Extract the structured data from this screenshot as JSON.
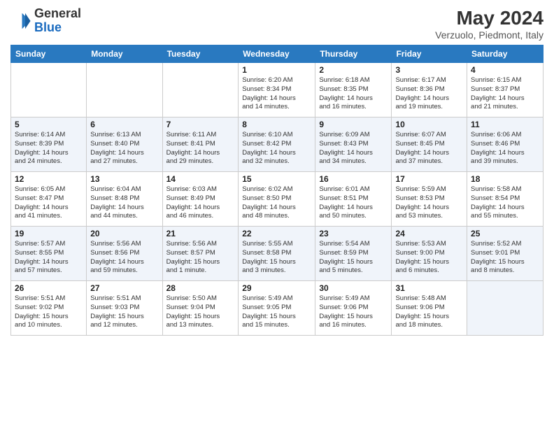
{
  "header": {
    "logo": {
      "line1": "General",
      "line2": "Blue"
    },
    "title": "May 2024",
    "location": "Verzuolo, Piedmont, Italy"
  },
  "weekdays": [
    "Sunday",
    "Monday",
    "Tuesday",
    "Wednesday",
    "Thursday",
    "Friday",
    "Saturday"
  ],
  "weeks": [
    [
      {
        "day": "",
        "info": ""
      },
      {
        "day": "",
        "info": ""
      },
      {
        "day": "",
        "info": ""
      },
      {
        "day": "1",
        "info": "Sunrise: 6:20 AM\nSunset: 8:34 PM\nDaylight: 14 hours\nand 14 minutes."
      },
      {
        "day": "2",
        "info": "Sunrise: 6:18 AM\nSunset: 8:35 PM\nDaylight: 14 hours\nand 16 minutes."
      },
      {
        "day": "3",
        "info": "Sunrise: 6:17 AM\nSunset: 8:36 PM\nDaylight: 14 hours\nand 19 minutes."
      },
      {
        "day": "4",
        "info": "Sunrise: 6:15 AM\nSunset: 8:37 PM\nDaylight: 14 hours\nand 21 minutes."
      }
    ],
    [
      {
        "day": "5",
        "info": "Sunrise: 6:14 AM\nSunset: 8:39 PM\nDaylight: 14 hours\nand 24 minutes."
      },
      {
        "day": "6",
        "info": "Sunrise: 6:13 AM\nSunset: 8:40 PM\nDaylight: 14 hours\nand 27 minutes."
      },
      {
        "day": "7",
        "info": "Sunrise: 6:11 AM\nSunset: 8:41 PM\nDaylight: 14 hours\nand 29 minutes."
      },
      {
        "day": "8",
        "info": "Sunrise: 6:10 AM\nSunset: 8:42 PM\nDaylight: 14 hours\nand 32 minutes."
      },
      {
        "day": "9",
        "info": "Sunrise: 6:09 AM\nSunset: 8:43 PM\nDaylight: 14 hours\nand 34 minutes."
      },
      {
        "day": "10",
        "info": "Sunrise: 6:07 AM\nSunset: 8:45 PM\nDaylight: 14 hours\nand 37 minutes."
      },
      {
        "day": "11",
        "info": "Sunrise: 6:06 AM\nSunset: 8:46 PM\nDaylight: 14 hours\nand 39 minutes."
      }
    ],
    [
      {
        "day": "12",
        "info": "Sunrise: 6:05 AM\nSunset: 8:47 PM\nDaylight: 14 hours\nand 41 minutes."
      },
      {
        "day": "13",
        "info": "Sunrise: 6:04 AM\nSunset: 8:48 PM\nDaylight: 14 hours\nand 44 minutes."
      },
      {
        "day": "14",
        "info": "Sunrise: 6:03 AM\nSunset: 8:49 PM\nDaylight: 14 hours\nand 46 minutes."
      },
      {
        "day": "15",
        "info": "Sunrise: 6:02 AM\nSunset: 8:50 PM\nDaylight: 14 hours\nand 48 minutes."
      },
      {
        "day": "16",
        "info": "Sunrise: 6:01 AM\nSunset: 8:51 PM\nDaylight: 14 hours\nand 50 minutes."
      },
      {
        "day": "17",
        "info": "Sunrise: 5:59 AM\nSunset: 8:53 PM\nDaylight: 14 hours\nand 53 minutes."
      },
      {
        "day": "18",
        "info": "Sunrise: 5:58 AM\nSunset: 8:54 PM\nDaylight: 14 hours\nand 55 minutes."
      }
    ],
    [
      {
        "day": "19",
        "info": "Sunrise: 5:57 AM\nSunset: 8:55 PM\nDaylight: 14 hours\nand 57 minutes."
      },
      {
        "day": "20",
        "info": "Sunrise: 5:56 AM\nSunset: 8:56 PM\nDaylight: 14 hours\nand 59 minutes."
      },
      {
        "day": "21",
        "info": "Sunrise: 5:56 AM\nSunset: 8:57 PM\nDaylight: 15 hours\nand 1 minute."
      },
      {
        "day": "22",
        "info": "Sunrise: 5:55 AM\nSunset: 8:58 PM\nDaylight: 15 hours\nand 3 minutes."
      },
      {
        "day": "23",
        "info": "Sunrise: 5:54 AM\nSunset: 8:59 PM\nDaylight: 15 hours\nand 5 minutes."
      },
      {
        "day": "24",
        "info": "Sunrise: 5:53 AM\nSunset: 9:00 PM\nDaylight: 15 hours\nand 6 minutes."
      },
      {
        "day": "25",
        "info": "Sunrise: 5:52 AM\nSunset: 9:01 PM\nDaylight: 15 hours\nand 8 minutes."
      }
    ],
    [
      {
        "day": "26",
        "info": "Sunrise: 5:51 AM\nSunset: 9:02 PM\nDaylight: 15 hours\nand 10 minutes."
      },
      {
        "day": "27",
        "info": "Sunrise: 5:51 AM\nSunset: 9:03 PM\nDaylight: 15 hours\nand 12 minutes."
      },
      {
        "day": "28",
        "info": "Sunrise: 5:50 AM\nSunset: 9:04 PM\nDaylight: 15 hours\nand 13 minutes."
      },
      {
        "day": "29",
        "info": "Sunrise: 5:49 AM\nSunset: 9:05 PM\nDaylight: 15 hours\nand 15 minutes."
      },
      {
        "day": "30",
        "info": "Sunrise: 5:49 AM\nSunset: 9:06 PM\nDaylight: 15 hours\nand 16 minutes."
      },
      {
        "day": "31",
        "info": "Sunrise: 5:48 AM\nSunset: 9:06 PM\nDaylight: 15 hours\nand 18 minutes."
      },
      {
        "day": "",
        "info": ""
      }
    ]
  ]
}
